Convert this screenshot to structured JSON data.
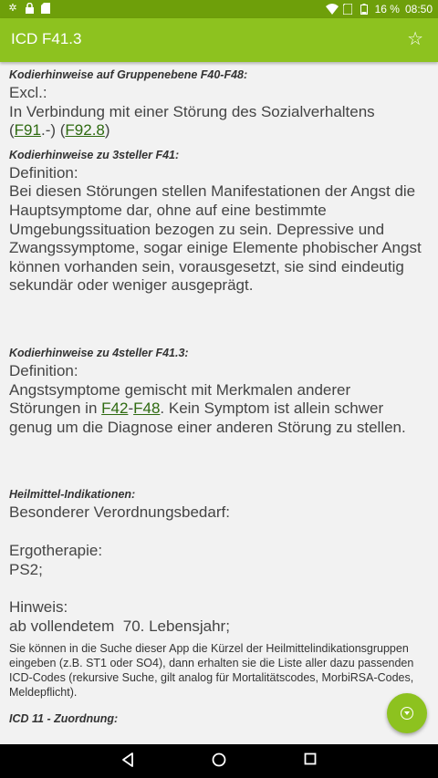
{
  "statusbar": {
    "battery_percent": "16 %",
    "time": "08:50"
  },
  "appbar": {
    "title": "ICD F41.3"
  },
  "group_section": {
    "header": "Kodierhinweise auf Gruppenebene F40-F48:",
    "label": "Excl.:",
    "line1": "In Verbindung mit einer Störung des Sozialverhaltens",
    "open_paren": "(",
    "link1": "F91",
    "mid": ".-) (",
    "link2": "F92.8",
    "close_paren": ")"
  },
  "three_section": {
    "header": "Kodierhinweise zu 3steller F41:",
    "label": "Definition:",
    "text": "Bei diesen Störungen stellen Manifestationen der Angst die Hauptsymptome dar, ohne auf eine bestimmte Umgebungssituation bezogen zu sein. Depressive und Zwangssymptome, sogar einige Elemente phobischer Angst können vorhanden sein, vorausgesetzt, sie sind eindeutig sekundär oder weniger ausgeprägt."
  },
  "four_section": {
    "header": "Kodierhinweise zu 4steller F41.3:",
    "label": "Definition:",
    "line1": "Angstsymptome gemischt mit Merkmalen anderer",
    "line2_pre": "Störungen in ",
    "link1": "F42",
    "dash": "-",
    "link2": "F48",
    "line2_post": ". Kein Symptom ist allein schwer",
    "line3": "genug um die Diagnose einer anderen Störung zu stellen."
  },
  "heilmittel": {
    "header": "Heilmittel-Indikationen:",
    "line1": "Besonderer Verordnungsbedarf:",
    "ergo_label": "Ergotherapie:",
    "ergo_value": "PS2;",
    "hint_label": "Hinweis:",
    "hint_value": "ab vollendetem  70. Lebensjahr;",
    "note": "Sie können in die Suche dieser App die Kürzel der Heilmittelindikationsgruppen eingeben (z.B. ST1 oder SO4), dann erhalten sie die Liste aller dazu passenden ICD-Codes (rekursive Suche, gilt analog für Mortalitätscodes, MorbiRSA-Codes, Meldepflicht)."
  },
  "icd11": {
    "header": "ICD 11 - Zuordnung:"
  },
  "icons": {
    "status_left": [
      "settings-icon",
      "lock-icon",
      "sd-card-icon"
    ],
    "status_right": [
      "wifi-icon",
      "no-sim-icon",
      "battery-icon"
    ],
    "star": "star-outline-icon",
    "fab": "scroll-down-icon",
    "nav": [
      "back-icon",
      "home-icon",
      "recents-icon"
    ]
  },
  "colors": {
    "statusbar": "#6e9f0a",
    "appbar": "#8dc21f",
    "link": "#2e6a10",
    "background": "#f2f2f2"
  }
}
